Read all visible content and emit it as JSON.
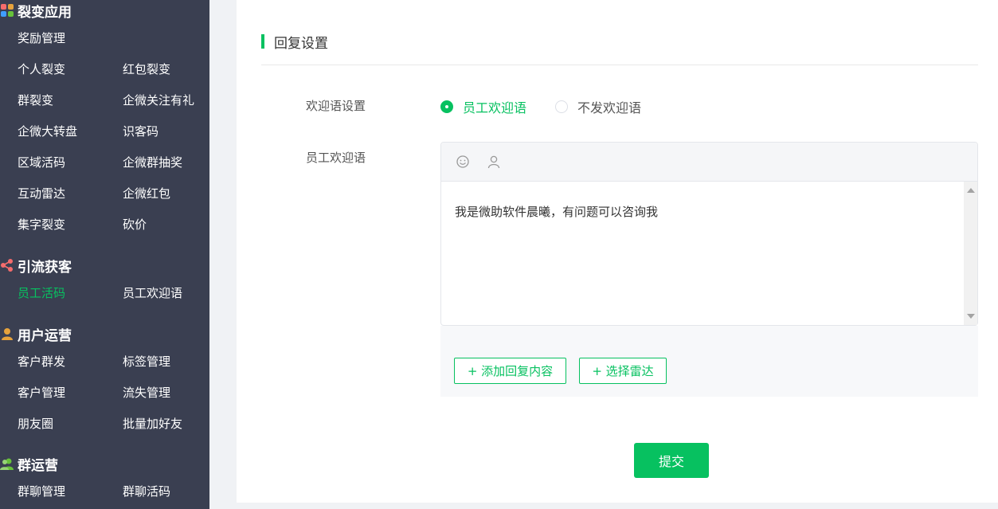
{
  "sidebar": {
    "sections": [
      {
        "title": "裂变应用",
        "items": [
          "奖励管理",
          "个人裂变",
          "红包裂变",
          "群裂变",
          "企微关注有礼",
          "企微大转盘",
          "识客码",
          "区域活码",
          "企微群抽奖",
          "互动雷达",
          "企微红包",
          "集字裂变",
          "砍价"
        ]
      },
      {
        "title": "引流获客",
        "items": [
          "员工活码",
          "员工欢迎语"
        ]
      },
      {
        "title": "用户运营",
        "items": [
          "客户群发",
          "标签管理",
          "客户管理",
          "流失管理",
          "朋友圈",
          "批量加好友"
        ]
      },
      {
        "title": "群运营",
        "items": [
          "群聊管理",
          "群聊活码"
        ]
      }
    ],
    "active_item": "员工活码"
  },
  "form": {
    "section_title": "回复设置",
    "welcome_label": "欢迎语设置",
    "radio_options": [
      "员工欢迎语",
      "不发欢迎语"
    ],
    "selected_option": "员工欢迎语",
    "message_label": "员工欢迎语",
    "message_text": "我是微助软件晨曦，有问题可以咨询我",
    "add_reply_button": "+ 添加回复内容",
    "select_radar_button": "+ 选择雷达",
    "submit_button": "提交"
  },
  "icons": {
    "toolbar": [
      "smiley-icon",
      "user-icon"
    ]
  },
  "colors": {
    "accent": "#07c160",
    "sidebar_bg": "#3a3f51"
  }
}
